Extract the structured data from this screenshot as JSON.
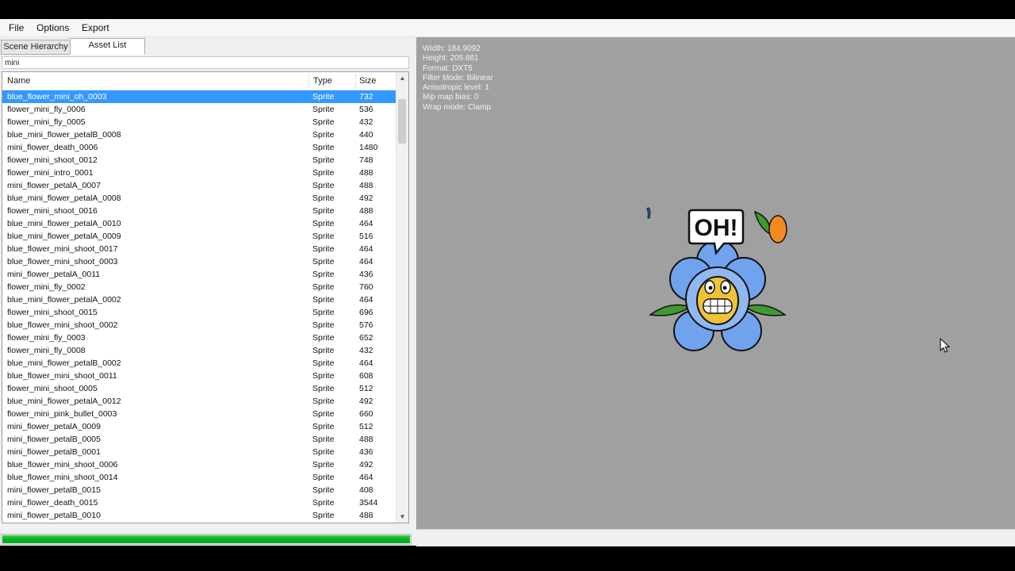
{
  "menu": [
    "File",
    "Options",
    "Export"
  ],
  "tabs": [
    {
      "label": "Scene Hierarchy",
      "active": false
    },
    {
      "label": "Asset List",
      "active": true
    }
  ],
  "search": {
    "value": "mini"
  },
  "columns": {
    "name": "Name",
    "type": "Type",
    "size": "Size"
  },
  "selected_index": 0,
  "rows": [
    [
      "blue_flower_mini_oh_0003",
      "Sprite",
      "732"
    ],
    [
      "flower_mini_fly_0006",
      "Sprite",
      "536"
    ],
    [
      "flower_mini_fly_0005",
      "Sprite",
      "432"
    ],
    [
      "blue_mini_flower_petalB_0008",
      "Sprite",
      "440"
    ],
    [
      "mini_flower_death_0006",
      "Sprite",
      "1480"
    ],
    [
      "flower_mini_shoot_0012",
      "Sprite",
      "748"
    ],
    [
      "flower_mini_intro_0001",
      "Sprite",
      "488"
    ],
    [
      "mini_flower_petalA_0007",
      "Sprite",
      "488"
    ],
    [
      "blue_mini_flower_petalA_0008",
      "Sprite",
      "492"
    ],
    [
      "flower_mini_shoot_0016",
      "Sprite",
      "488"
    ],
    [
      "blue_mini_flower_petalA_0010",
      "Sprite",
      "464"
    ],
    [
      "blue_mini_flower_petalA_0009",
      "Sprite",
      "516"
    ],
    [
      "blue_flower_mini_shoot_0017",
      "Sprite",
      "464"
    ],
    [
      "blue_flower_mini_shoot_0003",
      "Sprite",
      "464"
    ],
    [
      "mini_flower_petalA_0011",
      "Sprite",
      "436"
    ],
    [
      "flower_mini_fly_0002",
      "Sprite",
      "760"
    ],
    [
      "blue_mini_flower_petalA_0002",
      "Sprite",
      "464"
    ],
    [
      "flower_mini_shoot_0015",
      "Sprite",
      "696"
    ],
    [
      "blue_flower_mini_shoot_0002",
      "Sprite",
      "576"
    ],
    [
      "flower_mini_fly_0003",
      "Sprite",
      "652"
    ],
    [
      "flower_mini_fly_0008",
      "Sprite",
      "432"
    ],
    [
      "blue_mini_flower_petalB_0002",
      "Sprite",
      "464"
    ],
    [
      "blue_flower_mini_shoot_0011",
      "Sprite",
      "608"
    ],
    [
      "flower_mini_shoot_0005",
      "Sprite",
      "512"
    ],
    [
      "blue_mini_flower_petalA_0012",
      "Sprite",
      "492"
    ],
    [
      "flower_mini_pink_bullet_0003",
      "Sprite",
      "660"
    ],
    [
      "mini_flower_petalA_0009",
      "Sprite",
      "512"
    ],
    [
      "mini_flower_petalB_0005",
      "Sprite",
      "488"
    ],
    [
      "mini_flower_petalB_0001",
      "Sprite",
      "436"
    ],
    [
      "blue_flower_mini_shoot_0006",
      "Sprite",
      "492"
    ],
    [
      "blue_flower_mini_shoot_0014",
      "Sprite",
      "464"
    ],
    [
      "mini_flower_petalB_0015",
      "Sprite",
      "408"
    ],
    [
      "mini_flower_death_0015",
      "Sprite",
      "3544"
    ],
    [
      "mini_flower_petalB_0010",
      "Sprite",
      "488"
    ]
  ],
  "info": [
    "Width: 184.9092",
    "Height: 205.881",
    "Format: DXT5",
    "Filter Mode: Bilinear",
    "Anisotropic level: 1",
    "Mip map bias: 0",
    "Wrap mode: Clamp"
  ],
  "sprite": {
    "speech_text": "OH!"
  },
  "progress": {
    "percent": 100
  },
  "colors": {
    "selection": "#3399ff",
    "progress": "#06b025",
    "preview_bg": "#a0a0a0",
    "petal": "#6fa3ee",
    "petal_dark": "#2f64c9",
    "leaf": "#3f9a2f",
    "face": "#f0c23a"
  },
  "icons": [
    "scroll-up-arrow-icon",
    "scroll-down-arrow-icon",
    "mouse-pointer-icon"
  ]
}
